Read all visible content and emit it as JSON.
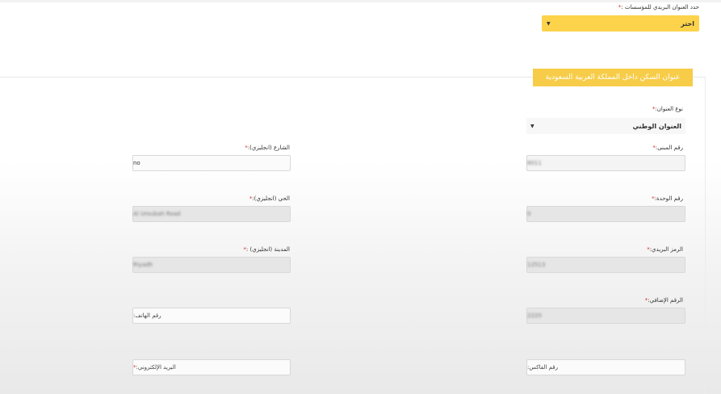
{
  "institutions_address": {
    "label": "حدد العنوان البريدي للمؤسسات :",
    "required_mark": "*",
    "select_value": "اختر"
  },
  "section": {
    "title": "عنوان السكن داخل المملكة العربية السعودية"
  },
  "address_type": {
    "label": "نوع العنوان:",
    "required_mark": "*",
    "value": "العنوان الوطني"
  },
  "fields": {
    "building_no": {
      "label": "رقم المبنى:",
      "required_mark": "*",
      "value": "8011"
    },
    "street_en": {
      "label": "الشارع (انجليزي):",
      "required_mark": "*",
      "value": "no"
    },
    "unit_no": {
      "label": "رقم الوحدة:",
      "required_mark": "*",
      "value": "0"
    },
    "district_en": {
      "label": "الحي (انجليزي):",
      "required_mark": "*",
      "value": "Al Uroubah Road"
    },
    "postal_code": {
      "label": "الرمز البريدي:",
      "required_mark": "*",
      "value": "12513"
    },
    "city_en": {
      "label": "المدينة (انجليزي) :",
      "required_mark": "*",
      "value": "Riyadh"
    },
    "additional_no": {
      "label": "الرقم الإضافي:",
      "required_mark": "*",
      "value": "2220"
    },
    "phone": {
      "placeholder": "رقم الهاتف:"
    },
    "fax": {
      "placeholder": "رقم الفاكس:"
    },
    "email": {
      "placeholder": "البريد الإلكتروني:",
      "required_mark": "*"
    }
  }
}
